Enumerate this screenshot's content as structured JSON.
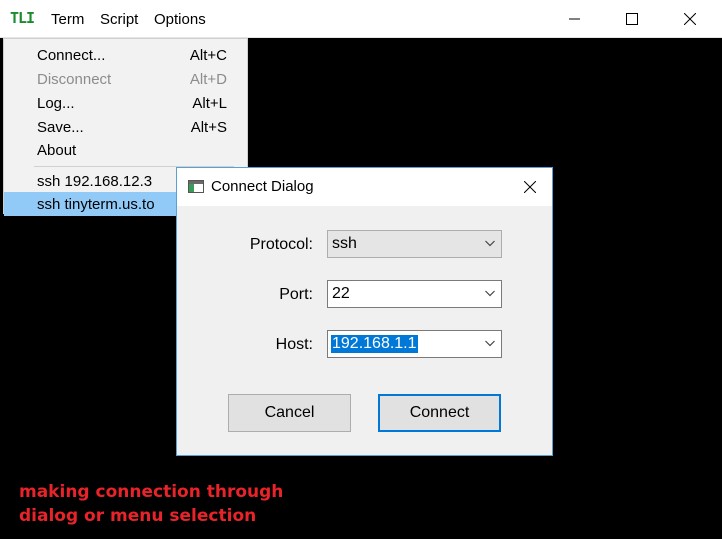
{
  "window": {
    "logo": "TLI",
    "menus": [
      "Term",
      "Script",
      "Options"
    ],
    "controls": {
      "minimize": "minimize-icon",
      "maximize": "maximize-icon",
      "close": "close-icon"
    }
  },
  "term_menu": {
    "items": [
      {
        "label": "Connect...",
        "shortcut": "Alt+C",
        "enabled": true
      },
      {
        "label": "Disconnect",
        "shortcut": "Alt+D",
        "enabled": false
      },
      {
        "label": "Log...",
        "shortcut": "Alt+L",
        "enabled": true
      },
      {
        "label": "Save...",
        "shortcut": "Alt+S",
        "enabled": true
      },
      {
        "label": "About",
        "shortcut": "",
        "enabled": true
      }
    ],
    "recent": [
      {
        "label": "ssh 192.168.12.3",
        "highlighted": false
      },
      {
        "label": "ssh tinyterm.us.to",
        "highlighted": true
      }
    ]
  },
  "dialog": {
    "title": "Connect Dialog",
    "protocol_label": "Protocol:",
    "protocol_value": "ssh",
    "port_label": "Port:",
    "port_value": "22",
    "host_label": "Host:",
    "host_value": "192.168.1.1",
    "cancel_label": "Cancel",
    "connect_label": "Connect"
  },
  "annotation": {
    "line1": "making connection through",
    "line2": "dialog or menu selection",
    "color": "#e8232a"
  },
  "colors": {
    "logo": "#1d8a2e",
    "highlight": "#91c9f7",
    "selection": "#0078d7",
    "dialog_border": "#5aa0d4"
  }
}
